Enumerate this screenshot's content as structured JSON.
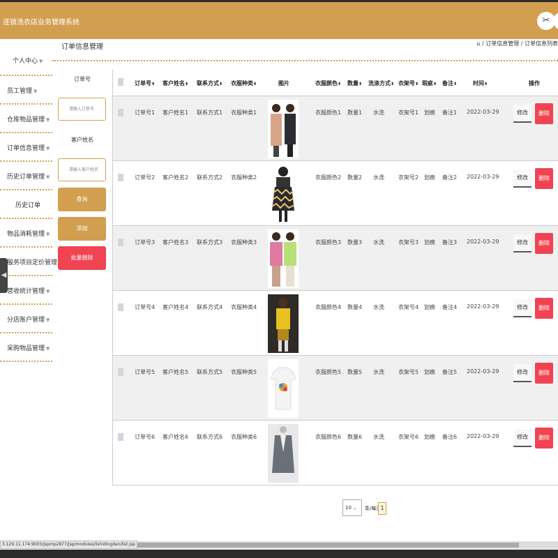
{
  "header": {
    "title": "连锁洗衣店业务管理系统",
    "icon_left": "scissors-icon",
    "icon_right": "user-icon"
  },
  "sidebar": {
    "items": [
      {
        "label": "个人中心"
      },
      {
        "label": "员工管理"
      },
      {
        "label": "仓库物品管理"
      },
      {
        "label": "订单信息管理"
      },
      {
        "label": "历史订单管理"
      },
      {
        "label": "历史订单"
      },
      {
        "label": "物品消耗管理"
      },
      {
        "label": "服务项目定价管理"
      },
      {
        "label": "营收统计管理"
      },
      {
        "label": "分店账户管理"
      },
      {
        "label": "采购物品管理"
      }
    ]
  },
  "page": {
    "title": "订单信息管理",
    "breadcrumb": "/ 订单信息管理 / 订单信息列表"
  },
  "filters": {
    "order_label": "订单号",
    "order_placeholder": "请输入订单号",
    "name_label": "客户姓名",
    "name_placeholder": "请输入客户姓名",
    "query_btn": "查询",
    "add_btn": "添加",
    "batch_delete_btn": "批量删除"
  },
  "table": {
    "headers": [
      "订单号",
      "客户姓名",
      "联系方式",
      "衣服种类",
      "图片",
      "衣服颜色",
      "数量",
      "洗涤方式",
      "衣架号",
      "瑕疵",
      "备注",
      "时间",
      "操作"
    ],
    "rows": [
      {
        "order": "订单号1",
        "name": "客户姓名1",
        "contact": "联系方式1",
        "type": "衣服种类1",
        "color": "衣服颜色1",
        "qty": "数量1",
        "wash": "水洗",
        "hanger": "衣架号1",
        "flaw": "划痕",
        "note": "备注1",
        "time": "2022-03-29",
        "pic": "coat"
      },
      {
        "order": "订单号2",
        "name": "客户姓名2",
        "contact": "联系方式2",
        "type": "衣服种类2",
        "color": "衣服颜色2",
        "qty": "数量2",
        "wash": "水洗",
        "hanger": "衣架号2",
        "flaw": "划痕",
        "note": "备注2",
        "time": "2022-03-29",
        "pic": "dress"
      },
      {
        "order": "订单号3",
        "name": "客户姓名3",
        "contact": "联系方式3",
        "type": "衣服种类3",
        "color": "衣服颜色3",
        "qty": "数量3",
        "wash": "水洗",
        "hanger": "衣架号3",
        "flaw": "划痕",
        "note": "备注3",
        "time": "2022-03-29",
        "pic": "cardigan"
      },
      {
        "order": "订单号4",
        "name": "客户姓名4",
        "contact": "联系方式4",
        "type": "衣服种类4",
        "color": "衣服颜色4",
        "qty": "数量4",
        "wash": "水洗",
        "hanger": "衣架号4",
        "flaw": "划痕",
        "note": "备注4",
        "time": "2022-03-29",
        "pic": "yellow"
      },
      {
        "order": "订单号5",
        "name": "客户姓名5",
        "contact": "联系方式5",
        "type": "衣服种类5",
        "color": "衣服颜色5",
        "qty": "数量5",
        "wash": "水洗",
        "hanger": "衣架号5",
        "flaw": "划痕",
        "note": "备注5",
        "time": "2022-03-29",
        "pic": "tshirt"
      },
      {
        "order": "订单号6",
        "name": "客户姓名6",
        "contact": "联系方式6",
        "type": "衣服种类6",
        "color": "衣服颜色6",
        "qty": "数量6",
        "wash": "水洗",
        "hanger": "衣架号6",
        "flaw": "划痕",
        "note": "备注6",
        "time": "2022-03-29",
        "pic": "blazer"
      }
    ],
    "edit_label": "修改",
    "delete_label": "删除"
  },
  "pagination": {
    "page_size": "10",
    "per_page_text": "条/每页",
    "current_page": "1"
  },
  "status_bar": {
    "url": "3.129.11.174:9003/jspmp2877/jsp/modules/lishidingdan/list.jsp"
  },
  "colors": {
    "accent": "#d19f4f",
    "danger": "#f04452"
  }
}
